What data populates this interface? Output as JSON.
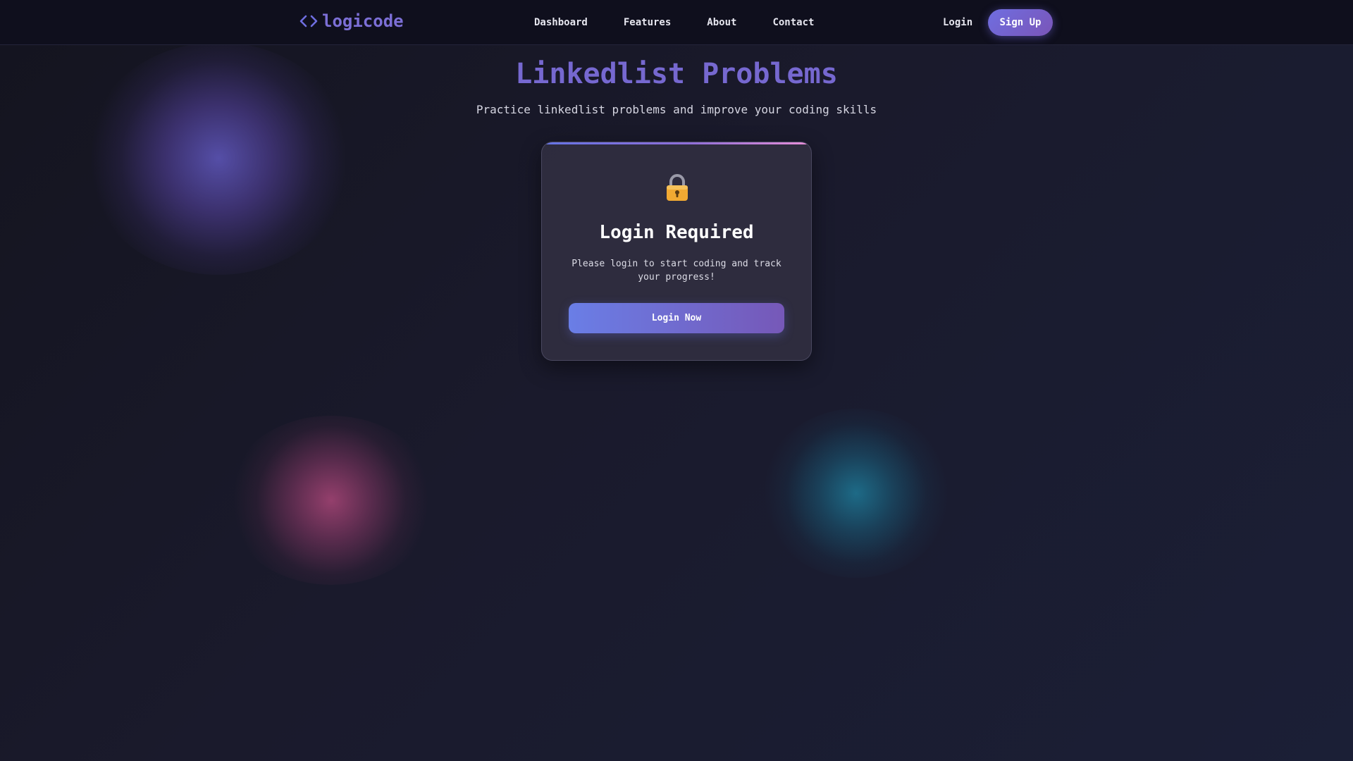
{
  "navbar": {
    "brand": "logicode",
    "brand_icon": "code-brackets-icon",
    "links": [
      {
        "label": "Dashboard"
      },
      {
        "label": "Features"
      },
      {
        "label": "About"
      },
      {
        "label": "Contact"
      }
    ],
    "login_label": "Login",
    "signup_label": "Sign Up"
  },
  "header": {
    "title": "Linkedlist Problems",
    "subtitle": "Practice linkedlist problems and improve your coding skills"
  },
  "login_card": {
    "icon": "lock-icon",
    "title": "Login Required",
    "message": "Please login to start coding and track your progress!",
    "button_label": "Login Now"
  },
  "colors": {
    "accent": "#7668d0",
    "background": "#1a1a2c",
    "navbar": "#0f0f1d",
    "button_gradient_start": "#6a7ee6",
    "button_gradient_end": "#7658b8",
    "lock": "#f0a830"
  }
}
